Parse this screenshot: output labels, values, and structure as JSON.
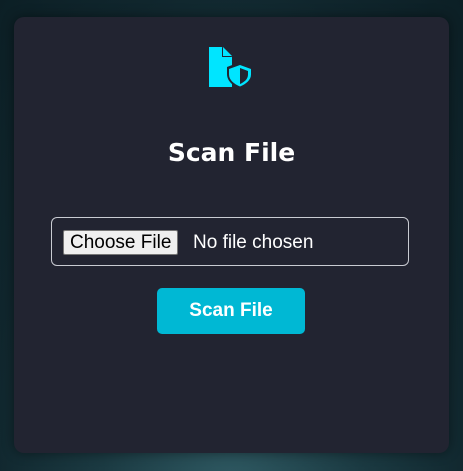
{
  "card": {
    "title": "Scan File",
    "icon": "file-shield-icon",
    "accent_color": "#00e5ff"
  },
  "file_input": {
    "button_label": "Choose File",
    "status_text": "No file chosen"
  },
  "actions": {
    "scan_label": "Scan File",
    "scan_color": "#00b8d4"
  }
}
